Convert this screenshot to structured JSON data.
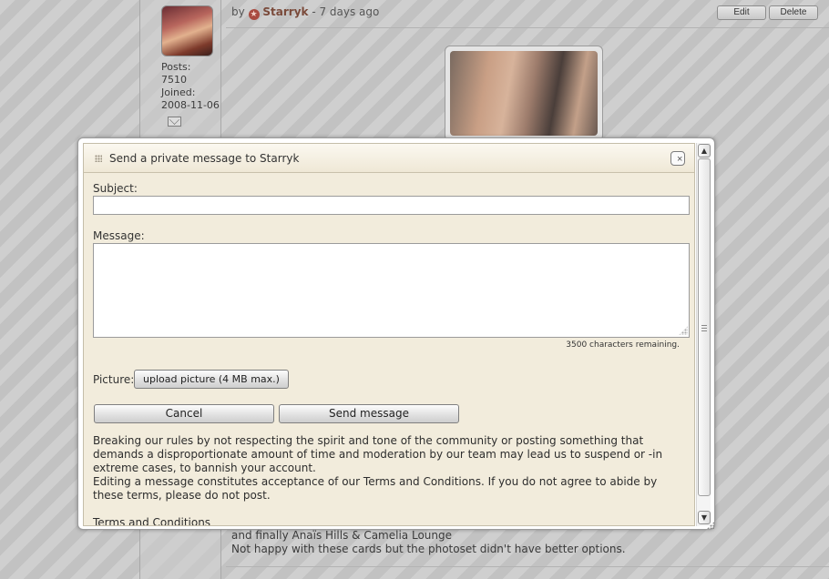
{
  "post": {
    "by_label": "by",
    "author": "Starryk",
    "time": "- 7 days ago",
    "edit_label": "Edit",
    "delete_label": "Delete",
    "posts_label": "Posts:",
    "posts_count": "7510",
    "joined_label": "Joined:",
    "joined_date": "2008-11-06",
    "text_line_1": "and finally Anaïs Hills & Camelia Lounge",
    "text_line_2": "Not happy with these cards but the photoset didn't have better options."
  },
  "dialog": {
    "title": "Send a private message to Starryk",
    "close_symbol": "×",
    "subject_label": "Subject:",
    "subject_value": "",
    "message_label": "Message:",
    "message_value": "",
    "chars_remaining": "3500 characters remaining.",
    "picture_label": "Picture:",
    "upload_label": "upload picture (4 MB max.)",
    "cancel_label": "Cancel",
    "send_label": "Send message",
    "rules_1": "Breaking our rules by not respecting the spirit and tone of the community or posting something that demands a disproportionate amount of time and moderation by our team may lead us to suspend or -in extreme cases, to bannish your account.",
    "rules_2": "Editing a message constitutes acceptance of our Terms and Conditions. If you do not agree to abide by these terms, please do not post.",
    "terms_link": "Terms and Conditions"
  },
  "icons": {
    "star": "star-badge-icon",
    "mail": "mail-icon",
    "grip": "drag-grip-icon",
    "close": "close-icon",
    "scroll_up": "arrow-up-icon",
    "scroll_down": "arrow-down-icon"
  },
  "colors": {
    "dialog_bg": "#f2ecdc",
    "author_color": "#7a4a3a",
    "badge_color": "#a94b40"
  }
}
